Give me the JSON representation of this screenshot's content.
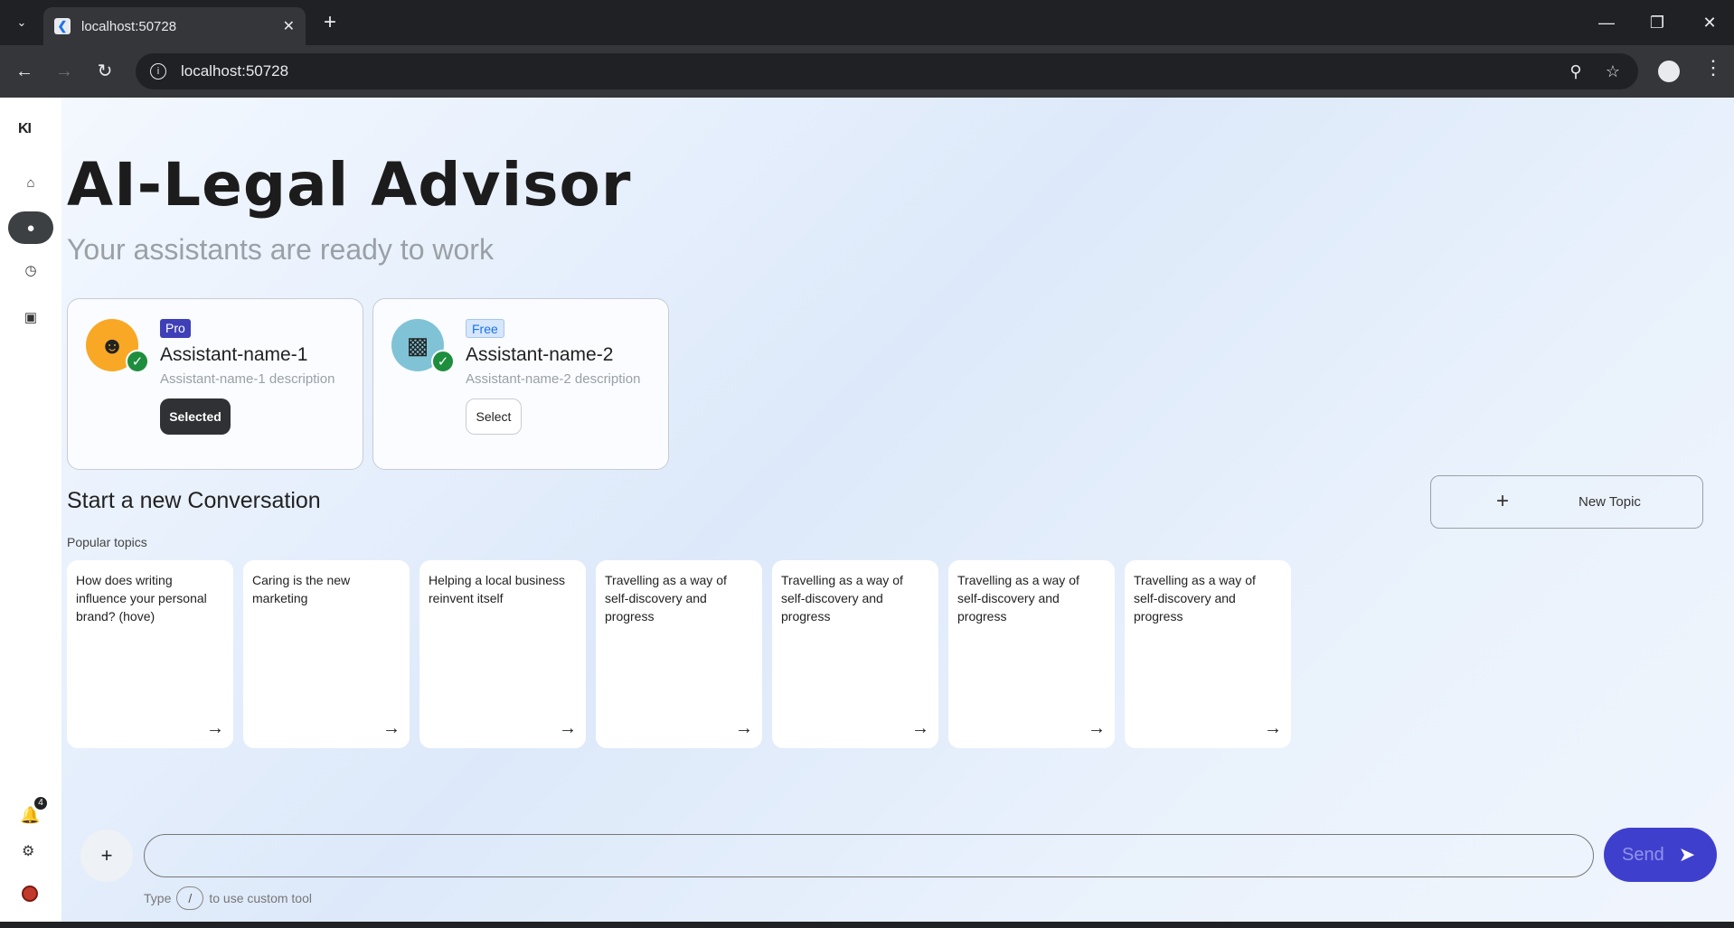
{
  "browser": {
    "tab_title": "localhost:50728",
    "favicon": "flutter-icon",
    "url": "localhost:50728"
  },
  "rail": {
    "logo": "KI",
    "items": [
      "home-icon",
      "chat-icon",
      "history-icon",
      "assistant-icon"
    ],
    "notification_count": "4"
  },
  "header": {
    "title": "AI-Legal Advisor",
    "subtitle": "Your assistants are ready to work"
  },
  "assistants": [
    {
      "badge": "Pro",
      "name": "Assistant-name-1",
      "description": "Assistant-name-1 description",
      "button": "Selected",
      "color": "#f9a825"
    },
    {
      "badge": "Free",
      "name": "Assistant-name-2",
      "description": "Assistant-name-2 description",
      "button": "Select",
      "color": "#80c3d6"
    }
  ],
  "conversation": {
    "title": "Start a new Conversation",
    "new_topic": "New Topic",
    "popular_label": "Popular topics",
    "topics": [
      "How does writing influence your personal brand? (hove)",
      "Caring is the new marketing",
      "Helping a local business reinvent itself",
      "Travelling as a way of self-discovery and progress",
      "Travelling as a way of self-discovery and progress",
      "Travelling as a way of self-discovery and progress",
      "Travelling as a way of self-discovery and progress"
    ]
  },
  "composer": {
    "placeholder": "",
    "send_label": "Send",
    "hint_prefix": "Type",
    "hint_key": "/",
    "hint_suffix": "to use custom tool"
  },
  "colors": {
    "accent": "#3f3fce",
    "pro_badge": "#3f3fb8",
    "success": "#1e8e3e"
  }
}
